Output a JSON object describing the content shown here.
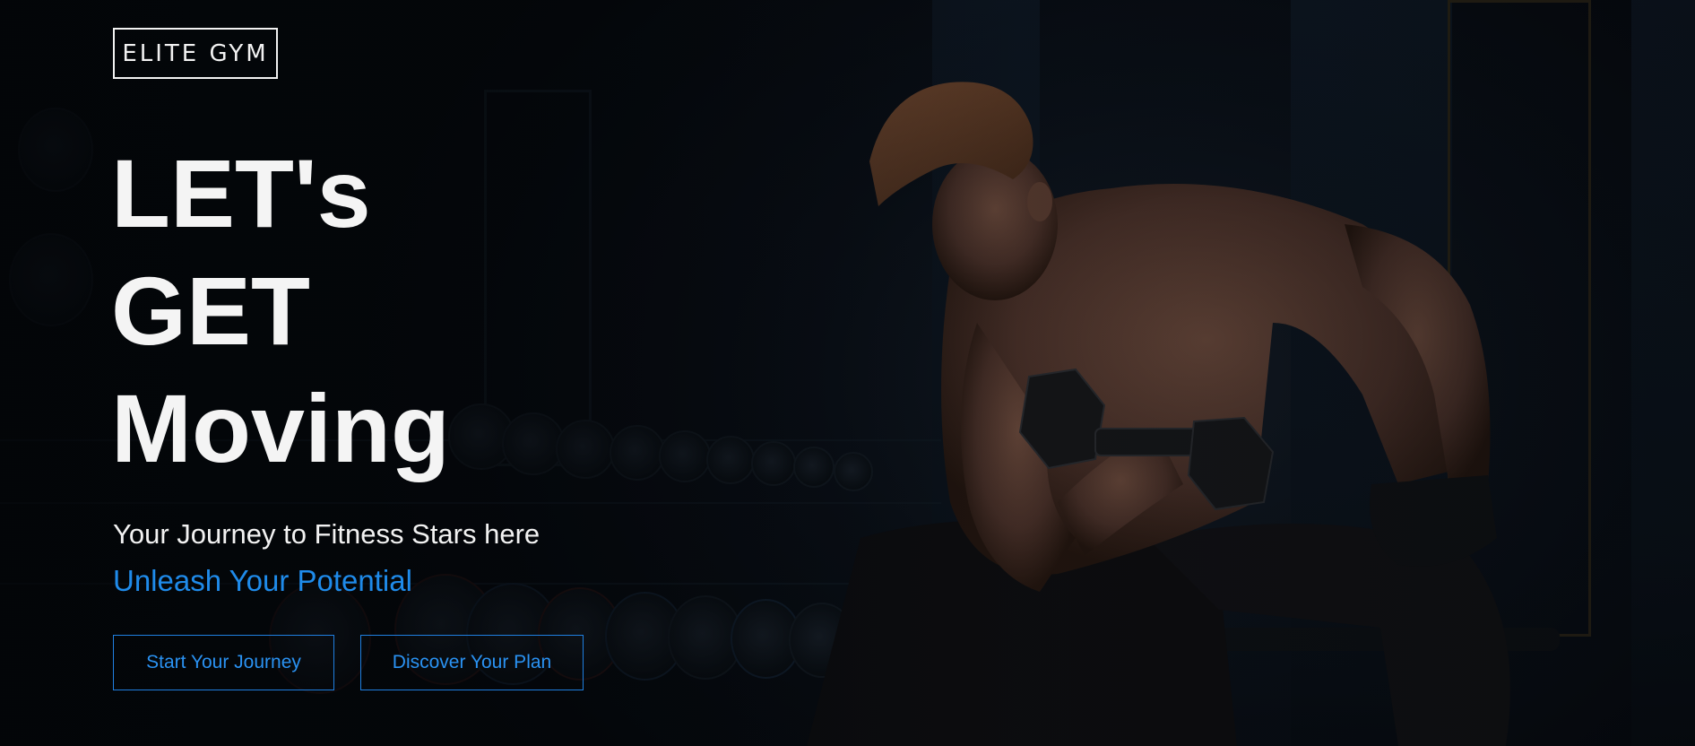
{
  "brand": {
    "logo_text": "ELITE GYM"
  },
  "hero": {
    "headline_lines": [
      "LET's",
      "GET",
      "Moving"
    ],
    "tagline": "Your Journey to Fitness Stars here",
    "subtagline": "Unleash Your Potential",
    "accent_color": "#1f8bea"
  },
  "actions": {
    "start_label": "Start Your Journey",
    "discover_label": "Discover Your Plan"
  },
  "background": {
    "image_subject": "athlete-curling-dumbbell-in-dark-gym"
  }
}
